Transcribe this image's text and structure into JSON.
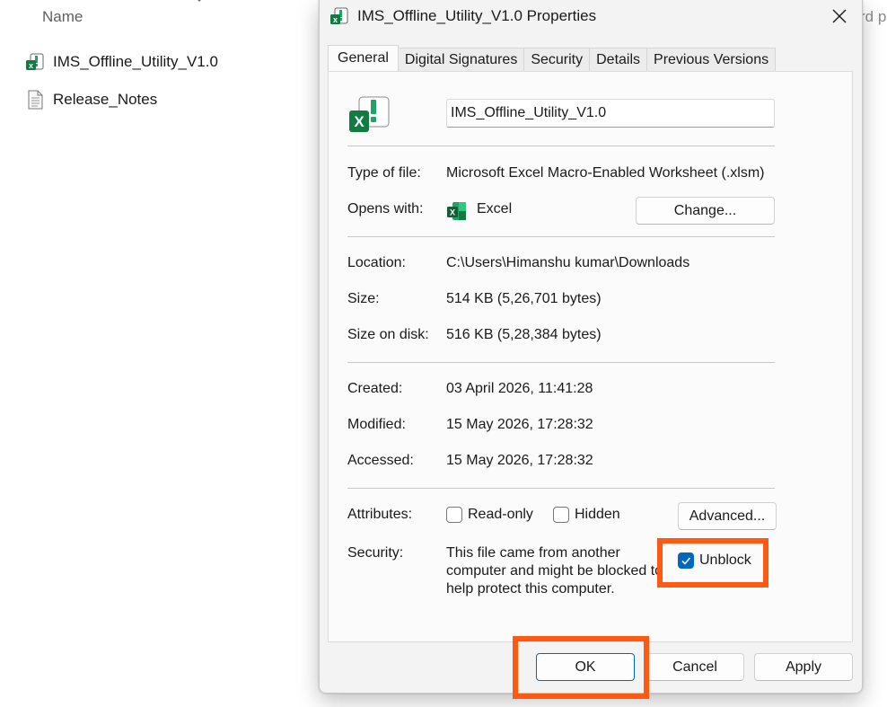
{
  "explorer": {
    "column_header": "Name",
    "files": [
      {
        "name": "IMS_Offline_Utility_V1.0",
        "icon": "excel-macro-icon"
      },
      {
        "name": "Release_Notes",
        "icon": "text-document-icon"
      }
    ],
    "right_fragment": "rd p"
  },
  "dialog": {
    "title": "IMS_Offline_Utility_V1.0 Properties",
    "tabs": [
      "General",
      "Digital Signatures",
      "Security",
      "Details",
      "Previous Versions"
    ],
    "active_tab": "General",
    "file_name_value": "IMS_Offline_Utility_V1.0",
    "type_label": "Type of file:",
    "type_value": "Microsoft Excel Macro-Enabled Worksheet (.xlsm)",
    "opens_label": "Opens with:",
    "opens_value": "Excel",
    "change_button": "Change...",
    "location_label": "Location:",
    "location_value": "C:\\Users\\Himanshu kumar\\Downloads",
    "size_label": "Size:",
    "size_value": "514 KB (5,26,701 bytes)",
    "size_disk_label": "Size on disk:",
    "size_disk_value": "516 KB (5,28,384 bytes)",
    "created_label": "Created:",
    "created_value": "03 April 2026, 11:41:28",
    "modified_label": "Modified:",
    "modified_value": "15 May 2026, 17:28:32",
    "accessed_label": "Accessed:",
    "accessed_value": "15 May 2026, 17:28:32",
    "attributes_label": "Attributes:",
    "readonly_label": "Read-only",
    "readonly_checked": false,
    "hidden_label": "Hidden",
    "hidden_checked": false,
    "advanced_button": "Advanced...",
    "security_label": "Security:",
    "security_text": "This file came from another computer and might be blocked to help protect this computer.",
    "unblock_label": "Unblock",
    "unblock_checked": true,
    "ok_button": "OK",
    "cancel_button": "Cancel",
    "apply_button": "Apply",
    "accent_color": "#0067c0",
    "highlight_color": "#ff5a14"
  }
}
